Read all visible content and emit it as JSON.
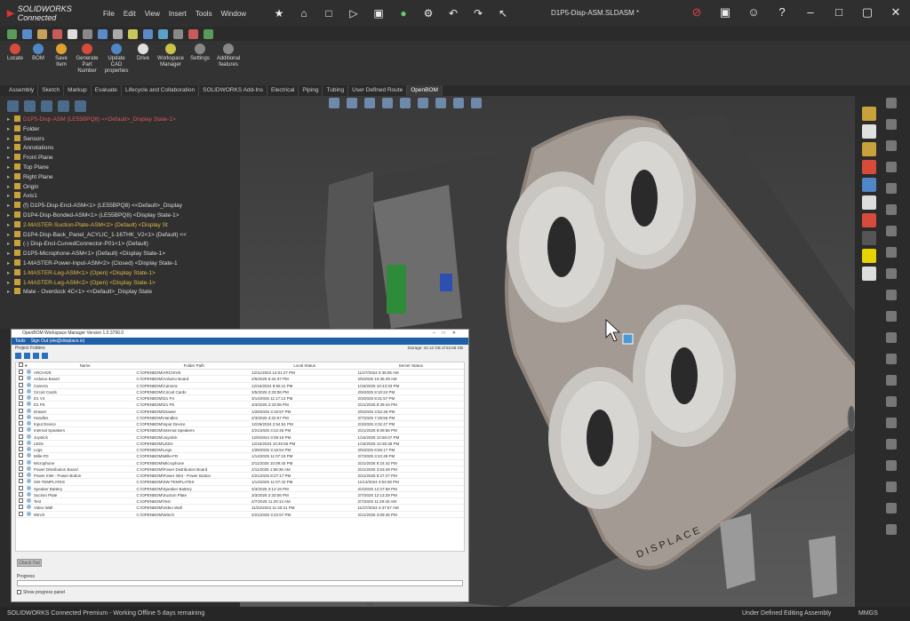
{
  "app": {
    "brand": "SOLIDWORKS Connected",
    "menu": [
      "File",
      "Edit",
      "View",
      "Insert",
      "Tools",
      "Window"
    ],
    "document_title": "D1P5-Disp-ASM.SLDASM *"
  },
  "command_manager": [
    {
      "label": "Locate",
      "icon": "locate-icon",
      "color": "#d64b3a"
    },
    {
      "label": "BOM",
      "icon": "bom-icon",
      "color": "#4f86c6"
    },
    {
      "label": "Save Item",
      "icon": "save-item-icon",
      "color": "#e0a030"
    },
    {
      "label": "Generate Part Number",
      "icon": "generate-icon",
      "color": "#d64b3a"
    },
    {
      "label": "Update CAD properties",
      "icon": "update-icon",
      "color": "#4f86c6"
    },
    {
      "label": "Drive",
      "icon": "drive-icon",
      "color": "#e0e0e0"
    },
    {
      "label": "Workspace Manager",
      "icon": "workspace-icon",
      "color": "#c9c34a"
    },
    {
      "label": "Settings",
      "icon": "settings-icon",
      "color": "#888888"
    },
    {
      "label": "Additional features",
      "icon": "more-icon",
      "color": "#888888"
    }
  ],
  "tabs": [
    "Assembly",
    "Sketch",
    "Markup",
    "Evaluate",
    "Lifecycle and Collaboration",
    "SOLIDWORKS Add-Ins",
    "Electrical",
    "Piping",
    "Tubing",
    "User Defined Route",
    "OpenBOM"
  ],
  "active_tab": "OpenBOM",
  "tree": [
    {
      "label": "D1P5-Disp-ASM (LE55BPQ8) <<Default>_Display State-1>",
      "state": "err"
    },
    {
      "label": "Folder",
      "state": "normal"
    },
    {
      "label": "Sensors",
      "state": "normal"
    },
    {
      "label": "Annotations",
      "state": "normal"
    },
    {
      "label": "Front Plane",
      "state": "normal"
    },
    {
      "label": "Top Plane",
      "state": "normal"
    },
    {
      "label": "Right Plane",
      "state": "normal"
    },
    {
      "label": "Origin",
      "state": "normal"
    },
    {
      "label": "Axis1",
      "state": "normal"
    },
    {
      "label": "(f) D1P5-Disp-Encl-ASM<1> (LE55BPQ8) <<Default>_Display",
      "state": "normal"
    },
    {
      "label": "D1P4-Disp-Bonded-ASM<1> (LE55BPQ8) <Display State-1>",
      "state": "normal"
    },
    {
      "label": "2-MASTER-Suction-Plate-ASM<2> (Default) <Display St",
      "state": "warn"
    },
    {
      "label": "D1P4-Disp-Back_Panel_ACYLIC_1-16THK_V2<1> (Default) <<",
      "state": "normal"
    },
    {
      "label": "(-) Disp-Encl-CurvedConnector-P01<1> (Default)",
      "state": "normal"
    },
    {
      "label": "D1P5-Microphone-ASM<1> (Default) <Display State-1>",
      "state": "normal"
    },
    {
      "label": "1-MASTER-Power-Input-ASM<2> (Closed) <Display State-1",
      "state": "normal"
    },
    {
      "label": "1-MASTER-Leg-ASM<1> (Open) <Display State-1>",
      "state": "warn"
    },
    {
      "label": "1-MASTER-Leg-ASM<2> (Open) <Display State-1>",
      "state": "warn"
    },
    {
      "label": "Mate - Overdock 4C<1> <<Default>_Display State",
      "state": "normal"
    }
  ],
  "dialog": {
    "title": "OpenBOM Workspace Manager Version 1.0.3796.0",
    "menu": [
      "Tools",
      "Sign Out (ele@disiplace.io)"
    ],
    "folders_label": "Project Folders",
    "storage": "Storage: 44.12 GB of 53.68 GB",
    "columns": [
      "",
      "",
      "Name",
      "Folder Path",
      "Local Status",
      "Server Status"
    ],
    "rows": [
      [
        "ARCHIVE",
        "C:\\OPENBOM\\ARCHIVE",
        "12/11/2024 12:01:27 PM",
        "11/27/2024 5:36:06 AM"
      ],
      [
        "Arduino Board",
        "C:\\OPENBOM\\Arduino Board",
        "2/6/2025 6:34:37 PM",
        "2/5/2025 10:35:49 AM"
      ],
      [
        "Camera",
        "C:\\OPENBOM\\Camera",
        "12/16/2024 9:55:11 PM",
        "1/16/2025 10:43:33 PM"
      ],
      [
        "Circuit Cards",
        "C:\\OPENBOM\\Circuit Cards",
        "3/5/2025 2:33:06 PM",
        "2/5/2025 8:10:24 PM"
      ],
      [
        "D1 V4",
        "C:\\OPENBOM\\D1 P4",
        "3/14/2025 11:17:13 PM",
        "2/3/2025 8:31:57 PM"
      ],
      [
        "D1 P5",
        "C:\\OPENBOM\\D1 P5",
        "3/3/2025 2:33:06 PM",
        "2/21/2025 8:39:44 PM"
      ],
      [
        "Drawer",
        "C:\\OPENBOM\\Drawer",
        "1/28/2025 3:19:57 PM",
        "2/5/2025 3:52:46 PM"
      ],
      [
        "Handles",
        "C:\\OPENBOM\\Handles",
        "2/3/2025 3:32:57 PM",
        "2/7/2025 7:28:56 PM"
      ],
      [
        "Input Device",
        "C:\\OPENBOM\\Input Device",
        "12/26/2024 2:54:51 PM",
        "2/3/2025 3:32:47 PM"
      ],
      [
        "Internal Speakers",
        "C:\\OPENBOM\\Internal Speakers",
        "2/21/2025 3:22:45 PM",
        "2/21/2025 8:09:56 PM"
      ],
      [
        "Joystick",
        "C:\\OPENBOM\\Joystick",
        "12/5/2024 3:09:15 PM",
        "1/16/2025 10:56:07 PM"
      ],
      [
        "LEDs",
        "C:\\OPENBOM\\LEDs",
        "12/16/2024 10:46:55 PM",
        "1/16/2025 10:36:38 PM"
      ],
      [
        "Legs",
        "C:\\OPENBOM\\Legs",
        "1/28/2025 3:16:54 PM",
        "2/5/2025 8:56:17 PM"
      ],
      [
        "Mille-FD",
        "C:\\OPENBOM\\Mille-FD",
        "1/14/2025 11:07:19 PM",
        "2/7/2025 3:22:49 PM"
      ],
      [
        "Microphone",
        "C:\\OPENBOM\\Microphone",
        "2/11/2025 10:09:40 PM",
        "2/21/2025 8:24:42 PM"
      ],
      [
        "Power Distribution Board",
        "C:\\OPENBOM\\Power Distribution Board",
        "2/11/2025 1:58:36 AM",
        "2/21/2025 3:53:49 PM"
      ],
      [
        "Power Inlet - Power Button",
        "C:\\OPENBOM\\Power Inlet - Power Button",
        "2/21/2025 8:27:17 PM",
        "2/21/2025 8:27:27 PM"
      ],
      [
        "SW-TEMPLATES",
        "C:\\OPENBOM\\SW-TEMPLATES",
        "1/14/2025 11:07:42 PM",
        "11/13/2024 3:53:38 PM"
      ],
      [
        "Speaker Battery",
        "C:\\OPENBOM\\Speaker Battery",
        "3/3/2025 3:12:19 PM",
        "2/4/2025 12:27:59 PM"
      ],
      [
        "Suction Plate",
        "C:\\OPENBOM\\Suction Plate",
        "3/3/2025 2:33:06 PM",
        "2/7/2025 12:13:29 PM"
      ],
      [
        "Test",
        "C:\\OPENBOM\\Test",
        "2/7/2025 11:29:13 AM",
        "2/7/2025 11:29:40 AM"
      ],
      [
        "Video Wall",
        "C:\\OPENBOM\\Video Wall",
        "11/22/2024 11:40:21 PM",
        "11/27/2024 4:37:57 AM"
      ],
      [
        "Winch",
        "C:\\OPENBOM\\Winch",
        "2/21/2025 3:22:57 PM",
        "2/21/2025 3:09:45 PM"
      ]
    ],
    "button_label": "Check Out",
    "progress_label": "Progress",
    "show_progress_label": "Show progress panel"
  },
  "status_bar": {
    "left": "SOLIDWORKS Connected Premium - Working Offline 5 days remaining",
    "mode": "Under Defined",
    "editing": "Editing Assembly",
    "units": "MMGS"
  },
  "colors": {
    "accent_blue": "#1f5fa8",
    "warning": "#e4b84a",
    "error": "#e05555",
    "viewport_panel": "#3d3d3d",
    "model_face": "#a39a93"
  },
  "model": {
    "engraving": "DISPLACE"
  }
}
